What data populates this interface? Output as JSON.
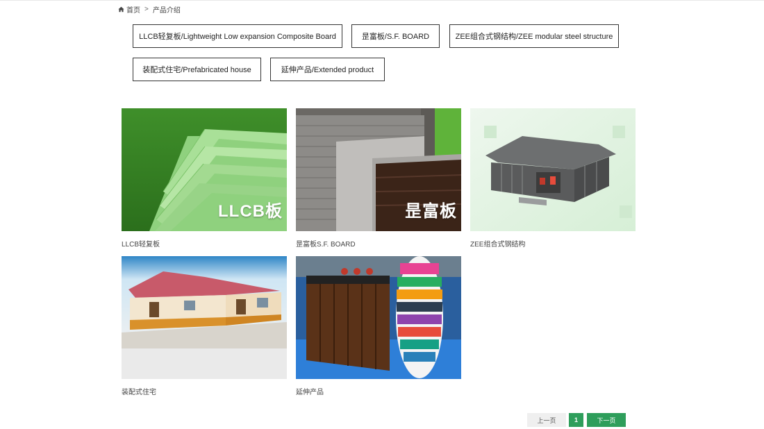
{
  "breadcrumb": {
    "home_label": "首页",
    "separator": ">",
    "current": "产品介绍"
  },
  "categories": [
    {
      "label": "LLCB轻复板/Lightweight Low expansion Composite Board"
    },
    {
      "label": "昰富板/S.F. BOARD"
    },
    {
      "label": "ZEE组合式钢结构/ZEE modular steel structure"
    },
    {
      "label": "装配式住宅/Prefabricated house"
    },
    {
      "label": "延伸产品/Extended product"
    }
  ],
  "products": [
    {
      "caption": "LLCB轻复板",
      "overlay": "LLCB板"
    },
    {
      "caption": "昰富板S.F. BOARD",
      "overlay": "昰富板"
    },
    {
      "caption": "ZEE组合式钢结构",
      "overlay": ""
    },
    {
      "caption": "装配式住宅",
      "overlay": ""
    },
    {
      "caption": "延伸产品",
      "overlay": ""
    }
  ],
  "pagination": {
    "prev_label": "上一页",
    "current_page": "1",
    "next_label": "下一页"
  },
  "colors": {
    "accent": "#2e9e5b",
    "border": "#333333"
  }
}
